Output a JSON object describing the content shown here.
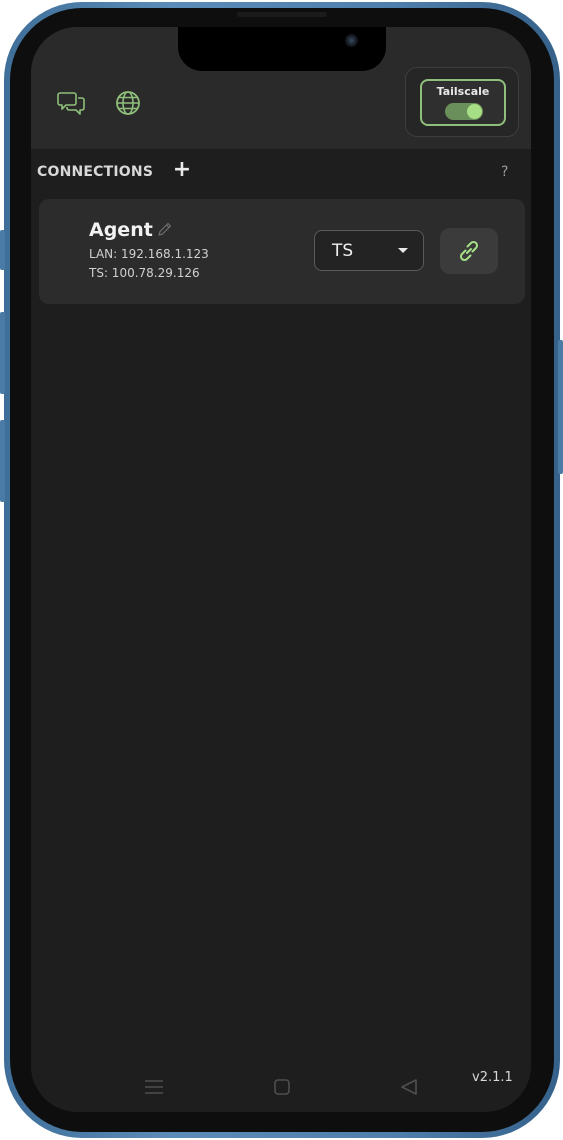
{
  "header": {
    "tailscale": {
      "label": "Tailscale",
      "enabled": true
    },
    "icons": [
      "chat-icon",
      "globe-icon"
    ]
  },
  "connections": {
    "title": "CONNECTIONS",
    "add_label": "+",
    "help_label": "?",
    "items": [
      {
        "name": "Agent",
        "lan": "LAN: 192.168.1.123",
        "ts": "TS: 100.78.29.126",
        "mode": "TS"
      }
    ]
  },
  "footer": {
    "version": "v2.1.1"
  },
  "colors": {
    "accent": "#8fbf7a",
    "background": "#1e1e1e",
    "header": "#2a2a2a",
    "card": "#2c2c2c"
  }
}
